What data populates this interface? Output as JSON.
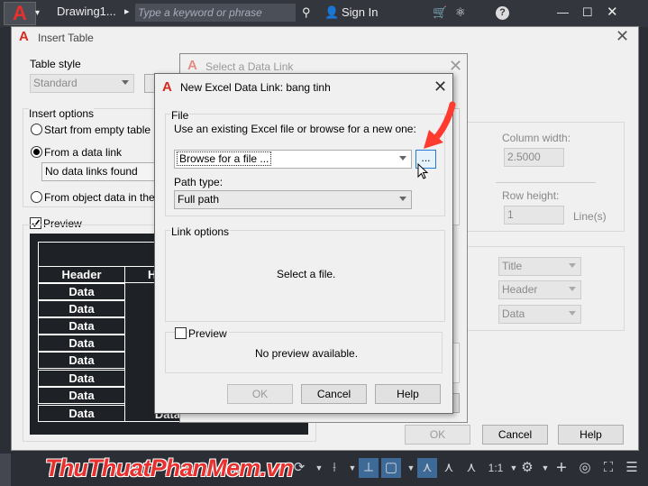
{
  "app": {
    "logo": "A",
    "logo_caret": "▾",
    "drawing_title": "Drawing1...",
    "nav_arrow": "▸",
    "search_placeholder": "Type a keyword or phrase",
    "sign_in": "Sign In",
    "help": "?",
    "minimize": "—",
    "maximize": "☐",
    "close": "✕"
  },
  "insert_table": {
    "title": "Insert Table",
    "table_style_label": "Table style",
    "table_style_value": "Standard",
    "insert_options_label": "Insert options",
    "start_empty": "Start from empty table",
    "from_data_link": "From a data link",
    "no_links": "No data links found",
    "from_object": "From object data in the d",
    "preview_label": "Preview",
    "column_width_label": "Column width:",
    "column_width_value": "2.5000",
    "row_height_label": "Row height:",
    "row_height_value": "1",
    "lines_label": "Line(s)",
    "title_style": "Title",
    "header_style": "Header",
    "data_style": "Data",
    "ok": "OK",
    "cancel": "Cancel",
    "help": "Help",
    "preview_header": "Header",
    "preview_header2": "H",
    "preview_rows": [
      "Data",
      "Data",
      "Data",
      "Data",
      "Data",
      "Data",
      "Data",
      "Data"
    ],
    "preview_last_right": "Data"
  },
  "select_link": {
    "title": "Select a Data Link"
  },
  "excel_link": {
    "title": "New Excel Data Link: bang tinh",
    "file_label": "File",
    "file_hint": "Use an existing Excel file or browse for a new one:",
    "browse_value": "Browse for a file ...",
    "browse_button": "...",
    "path_type_label": "Path type:",
    "path_type_value": "Full path",
    "link_options_label": "Link options",
    "select_file_msg": "Select a file.",
    "preview_label": "Preview",
    "no_preview": "No preview available.",
    "ok": "OK",
    "cancel": "Cancel",
    "help": "Help"
  },
  "watermark": {
    "text": "ThuThuatPhanMem.vn"
  },
  "statusbar": {
    "scale": "1:1"
  },
  "colors": {
    "accent_red": "#ff3b30",
    "autocad_red": "#d42a1f"
  }
}
